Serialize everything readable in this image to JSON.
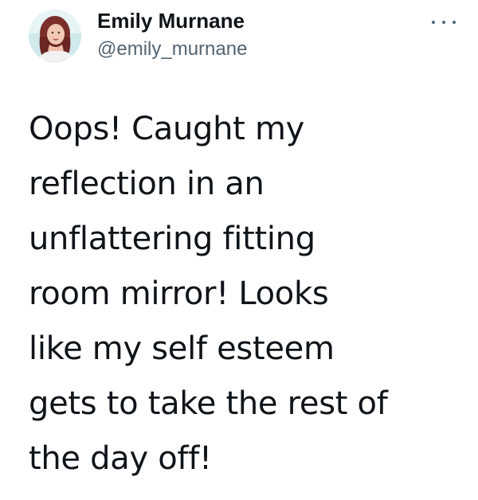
{
  "author": {
    "display_name": "Emily Murnane",
    "handle": "@emily_murnane",
    "avatar_icon": "profile-photo"
  },
  "menu": {
    "icon": "more-options-icon"
  },
  "tweet": {
    "text": "Oops! Caught my\nreflection in an\nunflattering fitting\nroom mirror! Looks\nlike my self esteem\ngets to take the rest of\nthe day off!"
  },
  "colors": {
    "text": "#0f1419",
    "secondary": "#536471",
    "background": "#ffffff",
    "avatar_bg": "#d9eef0"
  }
}
